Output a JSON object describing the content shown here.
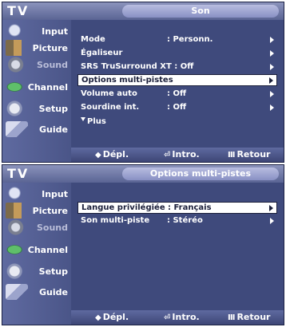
{
  "screens": [
    {
      "header_label": "TV",
      "title": "Son",
      "sidebar": [
        {
          "label": "Input",
          "icon": "input-icon",
          "active": true
        },
        {
          "label": "Picture",
          "icon": "picture-icon",
          "active": true
        },
        {
          "label": "Sound",
          "icon": "sound-icon",
          "active": false
        },
        {
          "label": "Channel",
          "icon": "channel-icon",
          "active": true
        },
        {
          "label": "Setup",
          "icon": "setup-icon",
          "active": true
        },
        {
          "label": "Guide",
          "icon": "guide-icon",
          "active": true
        }
      ],
      "menu": [
        {
          "name": "Mode",
          "value": ": Personn.",
          "arrow": true,
          "selected": false
        },
        {
          "name": "Égaliseur",
          "value": "",
          "arrow": true,
          "selected": false
        },
        {
          "name": "SRS TruSurround XT : Off",
          "value": "",
          "arrow": true,
          "selected": false
        },
        {
          "name": "Options multi-pistes",
          "value": "",
          "arrow": true,
          "selected": true
        },
        {
          "name": "Volume auto",
          "value": ": Off",
          "arrow": true,
          "selected": false
        },
        {
          "name": "Sourdine int.",
          "value": ": Off",
          "arrow": true,
          "selected": false
        }
      ],
      "more_label": "Plus",
      "footer": {
        "move": "Dépl.",
        "enter": "Intro.",
        "return": "Retour"
      }
    },
    {
      "header_label": "TV",
      "title": "Options multi-pistes",
      "sidebar": [
        {
          "label": "Input",
          "icon": "input-icon",
          "active": true
        },
        {
          "label": "Picture",
          "icon": "picture-icon",
          "active": true
        },
        {
          "label": "Sound",
          "icon": "sound-icon",
          "active": false
        },
        {
          "label": "Channel",
          "icon": "channel-icon",
          "active": true
        },
        {
          "label": "Setup",
          "icon": "setup-icon",
          "active": true
        },
        {
          "label": "Guide",
          "icon": "guide-icon",
          "active": true
        }
      ],
      "menu": [
        {
          "name": "Langue privilégiée",
          "value": ": Français",
          "arrow": true,
          "selected": true
        },
        {
          "name": "Son multi-piste",
          "value": ": Stéréo",
          "arrow": true,
          "selected": false
        }
      ],
      "more_label": "",
      "footer": {
        "move": "Dépl.",
        "enter": "Intro.",
        "return": "Retour"
      }
    }
  ]
}
